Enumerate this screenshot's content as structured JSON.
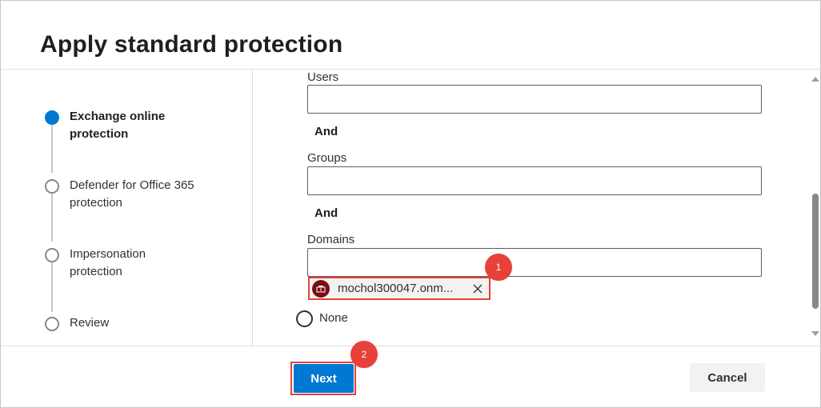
{
  "dialog": {
    "title": "Apply standard protection"
  },
  "steps": [
    {
      "label": "Exchange online protection",
      "state": "active"
    },
    {
      "label": "Defender for Office 365 protection",
      "state": "pending"
    },
    {
      "label": "Impersonation protection",
      "state": "pending"
    },
    {
      "label": "Review",
      "state": "pending"
    }
  ],
  "form": {
    "users_label": "Users",
    "users_value": "",
    "and_1": "And",
    "groups_label": "Groups",
    "groups_value": "",
    "and_2": "And",
    "domains_label": "Domains",
    "domains_value": "",
    "domain_chip": {
      "text": "mochol300047.onm...",
      "icon": "domain-icon"
    },
    "none_option": "None"
  },
  "annotations": {
    "badge_1": "1",
    "badge_2": "2",
    "highlight_color": "#e8413a"
  },
  "footer": {
    "next_label": "Next",
    "cancel_label": "Cancel"
  },
  "colors": {
    "accent": "#0078d4",
    "chip_avatar": "#7a0e12"
  }
}
